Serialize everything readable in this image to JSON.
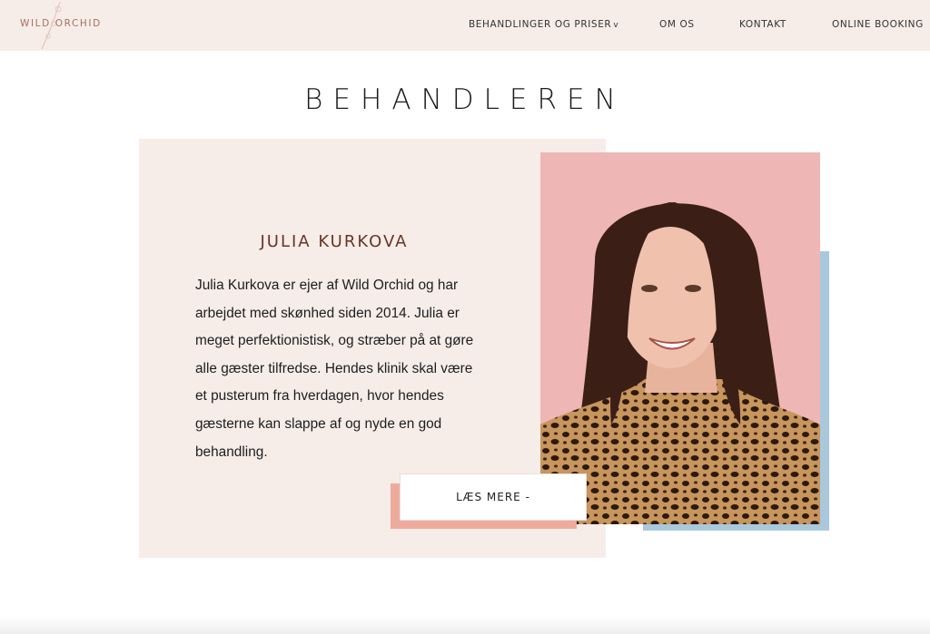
{
  "header": {
    "logo_text": "WILD ORCHID",
    "nav": [
      {
        "label": "BEHANDLINGER OG PRISER",
        "caret": "v"
      },
      {
        "label": "OM OS"
      },
      {
        "label": "KONTAKT"
      },
      {
        "label": "ONLINE BOOKING"
      }
    ]
  },
  "main": {
    "heading": "BEHANDLEREN",
    "person": {
      "name": "JULIA KURKOVA",
      "bio": "Julia Kurkova er ejer af Wild Orchid og har arbejdet med skønhed siden 2014. Julia er meget perfektionistisk, og stræber på at gøre alle gæster tilfredse. Hendes klinik skal være et pusterum fra hverdagen, hvor hendes gæsterne kan slappe af og nyde en god behandling.",
      "button_label": "LÆS MERE -"
    }
  },
  "colors": {
    "header_bg": "#f6ede9",
    "card_bg": "#f6ede9",
    "accent_blue": "#a9c8dc",
    "accent_salmon": "#eeab9c",
    "photo_bg": "#efb6b6",
    "name_color": "#6b3424"
  },
  "icons": {
    "logo": "orchid-branch-icon",
    "caret": "chevron-down-icon"
  }
}
